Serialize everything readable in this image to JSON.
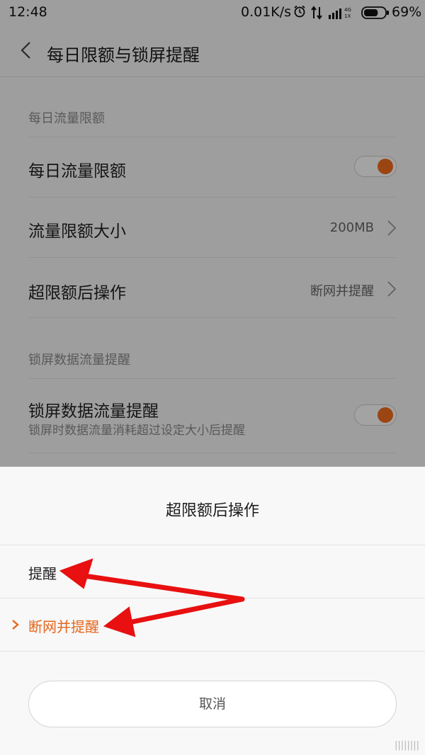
{
  "status_bar": {
    "time": "12:48",
    "net_speed": "0.01K/s",
    "alarm_icon": "alarm-icon",
    "data_icon": "data-sync-icon",
    "signal_icon": "signal-icon",
    "battery_percent": "69%",
    "battery_level": 0.69
  },
  "header": {
    "back_icon": "chevron-left-icon",
    "title": "每日限额与锁屏提醒"
  },
  "settings": {
    "daily_section": "每日流量限额",
    "daily_limit": {
      "label": "每日流量限额",
      "on": true
    },
    "limit_size": {
      "label": "流量限额大小",
      "value": "200MB"
    },
    "over_action": {
      "label": "超限额后操作",
      "value": "断网并提醒"
    },
    "lock_section": "锁屏数据流量提醒",
    "lock_reminder": {
      "label": "锁屏数据流量提醒",
      "sub": "锁屏时数据流量消耗超过设定大小后提醒",
      "on": true
    }
  },
  "sheet": {
    "title": "超限额后操作",
    "options": [
      {
        "label": "提醒",
        "selected": false
      },
      {
        "label": "断网并提醒",
        "selected": true
      }
    ],
    "cancel": "取消"
  },
  "colors": {
    "accent": "#e5661c",
    "arrow": "#e81010"
  },
  "watermark": "||||||||"
}
